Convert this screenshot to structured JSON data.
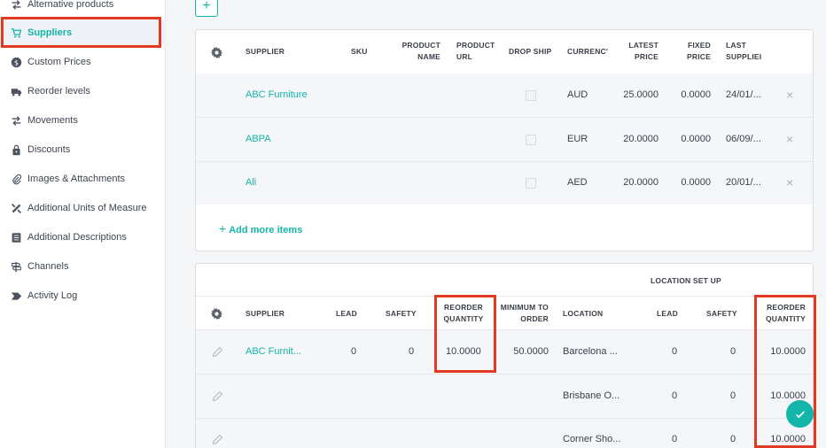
{
  "sidebar": {
    "items": [
      {
        "label": "Alternative products",
        "icon": "arrows-swap-icon"
      },
      {
        "label": "Suppliers",
        "icon": "cart-icon",
        "active": true
      },
      {
        "label": "Custom Prices",
        "icon": "dollar-circle-icon"
      },
      {
        "label": "Reorder levels",
        "icon": "truck-icon"
      },
      {
        "label": "Movements",
        "icon": "arrows-swap-icon"
      },
      {
        "label": "Discounts",
        "icon": "tag-lock-icon"
      },
      {
        "label": "Images & Attachments",
        "icon": "paperclip-icon"
      },
      {
        "label": "Additional Units of Measure",
        "icon": "ruler-pencil-icon"
      },
      {
        "label": "Additional Descriptions",
        "icon": "list-doc-icon"
      },
      {
        "label": "Channels",
        "icon": "signpost-icon"
      },
      {
        "label": "Activity Log",
        "icon": "arrow-tag-icon"
      }
    ]
  },
  "suppliers_table": {
    "headers": {
      "supplier": "SUPPLIER",
      "sku": "SKU",
      "product_name": [
        "PRODUCT",
        "NAME"
      ],
      "product_url": [
        "PRODUCT",
        "URL"
      ],
      "drop_ship": "DROP SHIP",
      "currency": "CURRENC'",
      "latest_price": [
        "LATEST",
        "PRICE"
      ],
      "fixed_price": [
        "FIXED",
        "PRICE"
      ],
      "last_supplied": [
        "LAST",
        "SUPPLIEI"
      ]
    },
    "rows": [
      {
        "supplier": "ABC Furniture",
        "currency": "AUD",
        "latest_price": "25.0000",
        "fixed_price": "0.0000",
        "last_supplied": "24/01/..."
      },
      {
        "supplier": "ABPA",
        "currency": "EUR",
        "latest_price": "20.0000",
        "fixed_price": "0.0000",
        "last_supplied": "06/09/..."
      },
      {
        "supplier": "Ali",
        "currency": "AED",
        "latest_price": "20.0000",
        "fixed_price": "0.0000",
        "last_supplied": "20/01/..."
      }
    ],
    "add_more": "Add more items"
  },
  "reorder_table": {
    "location_setup": "LOCATION SET UP",
    "headers": {
      "supplier": "SUPPLIER",
      "lead": "LEAD",
      "safety": "SAFETY",
      "reorder_quantity": [
        "REORDER",
        "QUANTITY"
      ],
      "minimum_to_order": [
        "MINIMUM TO",
        "ORDER"
      ],
      "location": "LOCATION",
      "loc_lead": "LEAD",
      "loc_safety": "SAFETY",
      "loc_reorder_quantity": [
        "REORDER",
        "QUANTITY"
      ]
    },
    "rows": [
      {
        "supplier": "ABC Furnit...",
        "lead": "0",
        "safety": "0",
        "reorder_quantity": "10.0000",
        "minimum_to_order": "50.0000",
        "location": "Barcelona ...",
        "loc_lead": "0",
        "loc_safety": "0",
        "loc_reorder_quantity": "10.0000"
      },
      {
        "supplier": "",
        "lead": "",
        "safety": "",
        "reorder_quantity": "",
        "minimum_to_order": "",
        "location": "Brisbane O...",
        "loc_lead": "0",
        "loc_safety": "0",
        "loc_reorder_quantity": "10.0000"
      },
      {
        "supplier": "",
        "lead": "",
        "safety": "",
        "reorder_quantity": "",
        "minimum_to_order": "",
        "location": "Corner Sho...",
        "loc_lead": "0",
        "loc_safety": "0",
        "loc_reorder_quantity": "10.0000"
      }
    ]
  },
  "colors": {
    "accent": "#13b5a8",
    "highlight": "#e03a22"
  },
  "buttons": {
    "add": "+"
  }
}
